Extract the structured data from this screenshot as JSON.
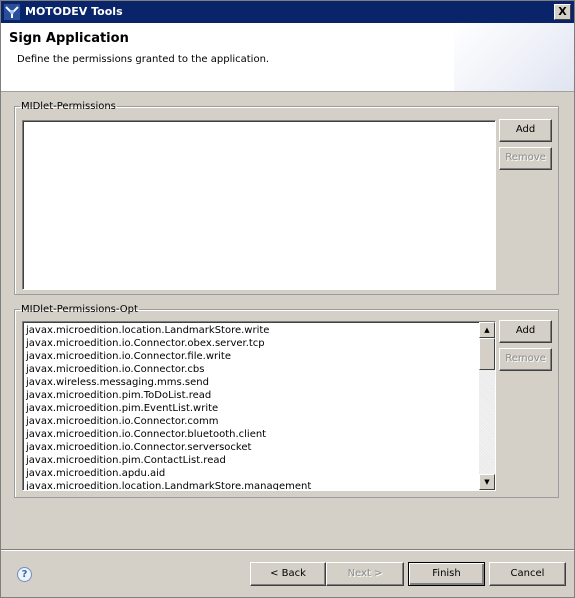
{
  "window": {
    "title": "MOTODEV Tools",
    "close_glyph": "X"
  },
  "banner": {
    "title": "Sign Application",
    "description": "Define the permissions granted to the application."
  },
  "permissions": {
    "legend": "MIDlet-Permissions",
    "items": [],
    "add_label": "Add",
    "remove_label": "Remove"
  },
  "permissions_opt": {
    "legend": "MIDlet-Permissions-Opt",
    "items": [
      "javax.microedition.location.LandmarkStore.write",
      "javax.microedition.io.Connector.obex.server.tcp",
      "javax.microedition.io.Connector.file.write",
      "javax.microedition.io.Connector.cbs",
      "javax.wireless.messaging.mms.send",
      "javax.microedition.pim.ToDoList.read",
      "javax.microedition.pim.EventList.write",
      "javax.microedition.io.Connector.comm",
      "javax.microedition.io.Connector.bluetooth.client",
      "javax.microedition.io.Connector.serversocket",
      "javax.microedition.pim.ContactList.read",
      "javax.microedition.apdu.aid",
      "javax.microedition.location.LandmarkStore.management"
    ],
    "add_label": "Add",
    "remove_label": "Remove"
  },
  "footer": {
    "help_glyph": "?",
    "back_label": "< Back",
    "next_label": "Next >",
    "finish_label": "Finish",
    "cancel_label": "Cancel"
  }
}
